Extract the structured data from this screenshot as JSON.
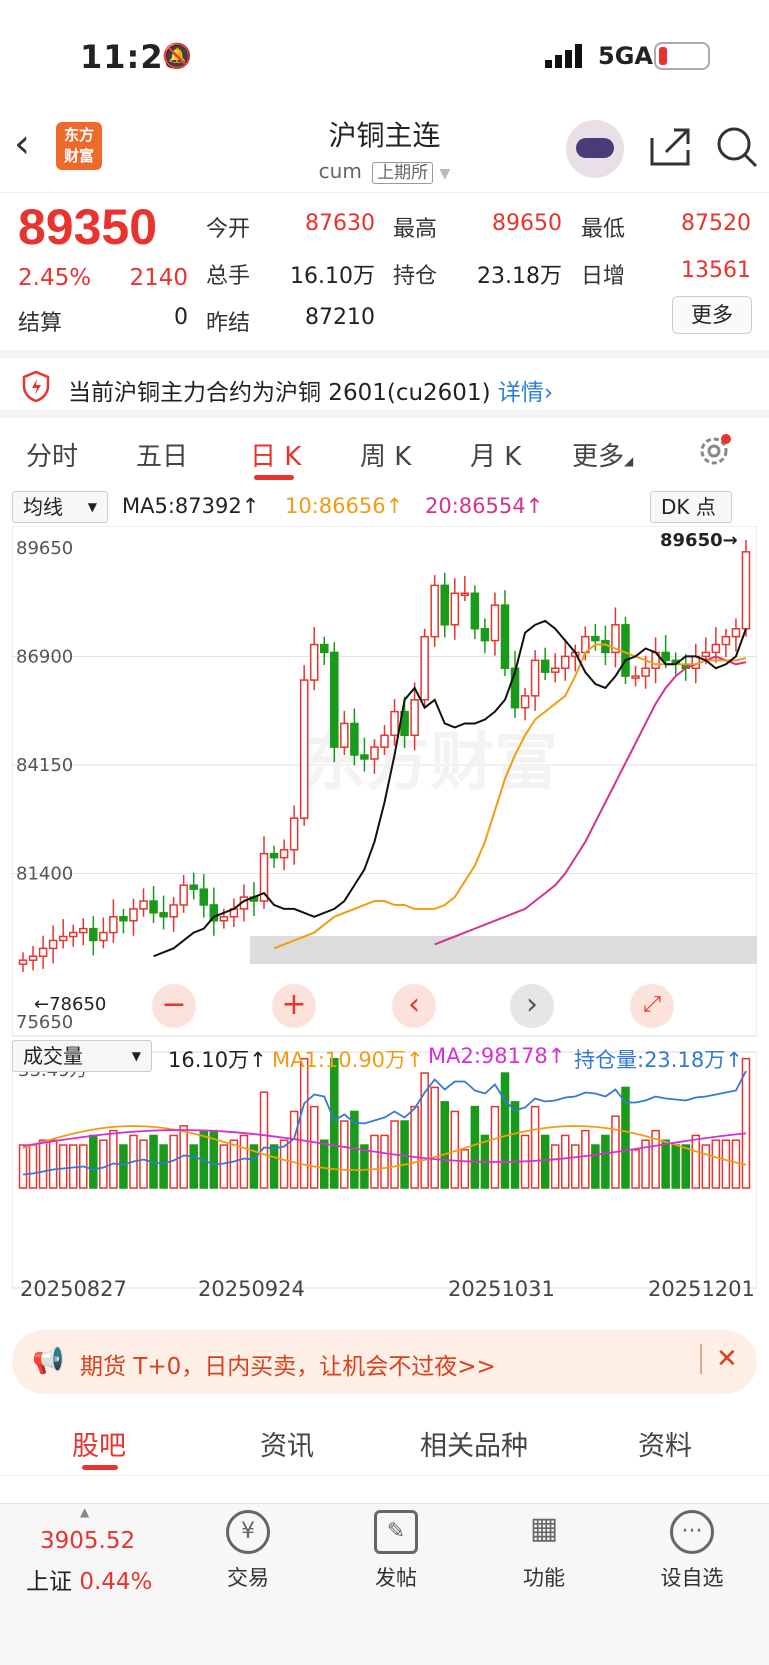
{
  "status": {
    "time": "11:28",
    "network": "5GA",
    "bell_icon": "bell-muted-icon"
  },
  "header": {
    "title": "沪铜主连",
    "code": "cum",
    "exchange": "上期所",
    "logo_line1": "东方",
    "logo_line2": "财富"
  },
  "quote": {
    "price": "89350",
    "change_pct": "2.45%",
    "change": "2140",
    "settle_label": "结算",
    "settle": "0",
    "fields": [
      {
        "label": "今开",
        "value": "87630",
        "color": "#e8332f"
      },
      {
        "label": "最高",
        "value": "89650",
        "color": "#e8332f"
      },
      {
        "label": "最低",
        "value": "87520",
        "color": "#e8332f"
      },
      {
        "label": "总手",
        "value": "16.10万",
        "color": "#222"
      },
      {
        "label": "持仓",
        "value": "23.18万",
        "color": "#222"
      },
      {
        "label": "日增",
        "value": "13561",
        "color": "#e8332f"
      },
      {
        "label": "昨结",
        "value": "87210",
        "color": "#222"
      }
    ],
    "more_label": "更多"
  },
  "notice": {
    "text": "当前沪铜主力合约为沪铜 2601(cu2601)",
    "link": "详情"
  },
  "tabs": [
    "分时",
    "五日",
    "日 K",
    "周 K",
    "月 K",
    "更多"
  ],
  "ma_legend": {
    "selector": "均线",
    "ma5": "MA5:87392",
    "ma10": "10:86656",
    "ma20": "20:86554",
    "dk": "DK 点"
  },
  "kline": {
    "price_labels": [
      "89650",
      "86900",
      "84150",
      "81400",
      "78650"
    ],
    "high_marker": "89650",
    "low_label": "75650",
    "low_marker": "78650",
    "watermark": "东方财富"
  },
  "volume_legend": {
    "selector": "成交量",
    "vol": "16.10万",
    "ma1": "MA1:10.90万",
    "ma2": "MA2:98178",
    "oi": "持仓量:23.18万",
    "max_label": "33.49万"
  },
  "dates": [
    "20250827",
    "20250924",
    "20251031",
    "20251201"
  ],
  "promo": {
    "text": "期货 T+0，日内买卖，让机会不过夜>>"
  },
  "bottom_tabs": [
    "股吧",
    "资讯",
    "相关品种",
    "资料"
  ],
  "nav": {
    "index_value": "3905.52",
    "index_name": "上证",
    "index_pct": "0.44%",
    "items": [
      {
        "label": "交易",
        "icon": "yen-icon"
      },
      {
        "label": "发帖",
        "icon": "edit-icon"
      },
      {
        "label": "功能",
        "icon": "grid-icon"
      },
      {
        "label": "设自选",
        "icon": "dots-icon"
      }
    ]
  },
  "chart_data": {
    "type": "candlestick",
    "x_ticks": [
      "20250827",
      "20250924",
      "20251031",
      "20251201"
    ],
    "y_ticks": [
      89650,
      86900,
      84150,
      81400,
      78650
    ],
    "ylim": [
      78650,
      89650
    ],
    "candles_close": [
      79000,
      79100,
      79300,
      79500,
      79600,
      79700,
      79800,
      79500,
      79700,
      80100,
      80000,
      80300,
      80500,
      80200,
      80100,
      80400,
      80900,
      80800,
      80400,
      80000,
      80100,
      80300,
      80600,
      80500,
      81700,
      81600,
      81800,
      82600,
      86100,
      87000,
      86800,
      84400,
      85000,
      84200,
      84100,
      84400,
      84700,
      85300,
      84700,
      85600,
      87200,
      88500,
      87500,
      88300,
      88300,
      87400,
      87100,
      88000,
      86400,
      85400,
      85700,
      86600,
      86300,
      86400,
      86700,
      86800,
      87200,
      87100,
      86800,
      87500,
      86200,
      86200,
      86400,
      86800,
      86600,
      86500,
      86400,
      86700,
      86800,
      87000,
      87200,
      87400,
      89350
    ],
    "ma5": [
      79100,
      79200,
      79300,
      79500,
      79700,
      79800,
      80100,
      80200,
      80300,
      80500,
      80600,
      80700,
      80400,
      80300,
      80300,
      80200,
      80100,
      80200,
      80300,
      80500,
      80900,
      81300,
      82000,
      83000,
      84200,
      85600,
      85900,
      85400,
      85600,
      85000,
      84900,
      85000,
      85000,
      85100,
      85300,
      85600,
      86300,
      87300,
      87500,
      87600,
      87400,
      87100,
      86800,
      86300,
      86000,
      85900,
      86200,
      86600,
      86700,
      86900,
      86800,
      86500,
      86500,
      86700,
      86700,
      86600,
      86400,
      86500,
      86700,
      87400
    ],
    "ma10": [
      79300,
      79400,
      79500,
      79600,
      79700,
      79900,
      80100,
      80200,
      80300,
      80400,
      80500,
      80500,
      80400,
      80400,
      80300,
      80300,
      80300,
      80400,
      80600,
      81000,
      81400,
      82000,
      82800,
      83600,
      84200,
      84700,
      85100,
      85300,
      85500,
      85700,
      86200,
      86800,
      87000,
      87000,
      86900,
      86800,
      86700,
      86600,
      86500,
      86500,
      86500,
      86500,
      86500,
      86600,
      86600,
      86600,
      86600,
      86656
    ],
    "ma20": [
      79400,
      79500,
      79600,
      79700,
      79800,
      79900,
      80000,
      80100,
      80200,
      80300,
      80500,
      80700,
      80900,
      81200,
      81600,
      82000,
      82500,
      83000,
      83500,
      84000,
      84500,
      85000,
      85500,
      85900,
      86200,
      86400,
      86500,
      86600,
      86700,
      86600,
      86500,
      86554
    ]
  }
}
